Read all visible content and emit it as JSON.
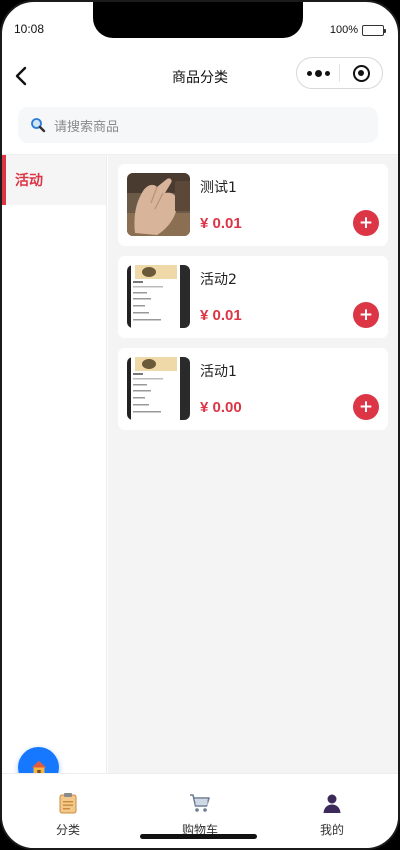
{
  "status_bar": {
    "time": "10:08",
    "battery_text": "100%",
    "battery_level": 1.0
  },
  "nav": {
    "title": "商品分类"
  },
  "search": {
    "placeholder": "请搜索商品"
  },
  "sidebar": {
    "items": [
      {
        "label": "活动",
        "active": true
      }
    ]
  },
  "products": [
    {
      "name": "测试1",
      "price": "¥ 0.01",
      "add_label": "+",
      "thumb": "hand-photo"
    },
    {
      "name": "活动2",
      "price": "¥ 0.01",
      "add_label": "+",
      "thumb": "page-screenshot"
    },
    {
      "name": "活动1",
      "price": "¥ 0.00",
      "add_label": "+",
      "thumb": "page-screenshot"
    }
  ],
  "tabbar": {
    "items": [
      {
        "label": "分类",
        "icon": "clipboard-icon"
      },
      {
        "label": "购物车",
        "icon": "cart-icon"
      },
      {
        "label": "我的",
        "icon": "user-icon"
      }
    ]
  },
  "colors": {
    "accent": "#dc3545",
    "fab": "#1677ff",
    "main_bg": "#f4f4f4"
  }
}
